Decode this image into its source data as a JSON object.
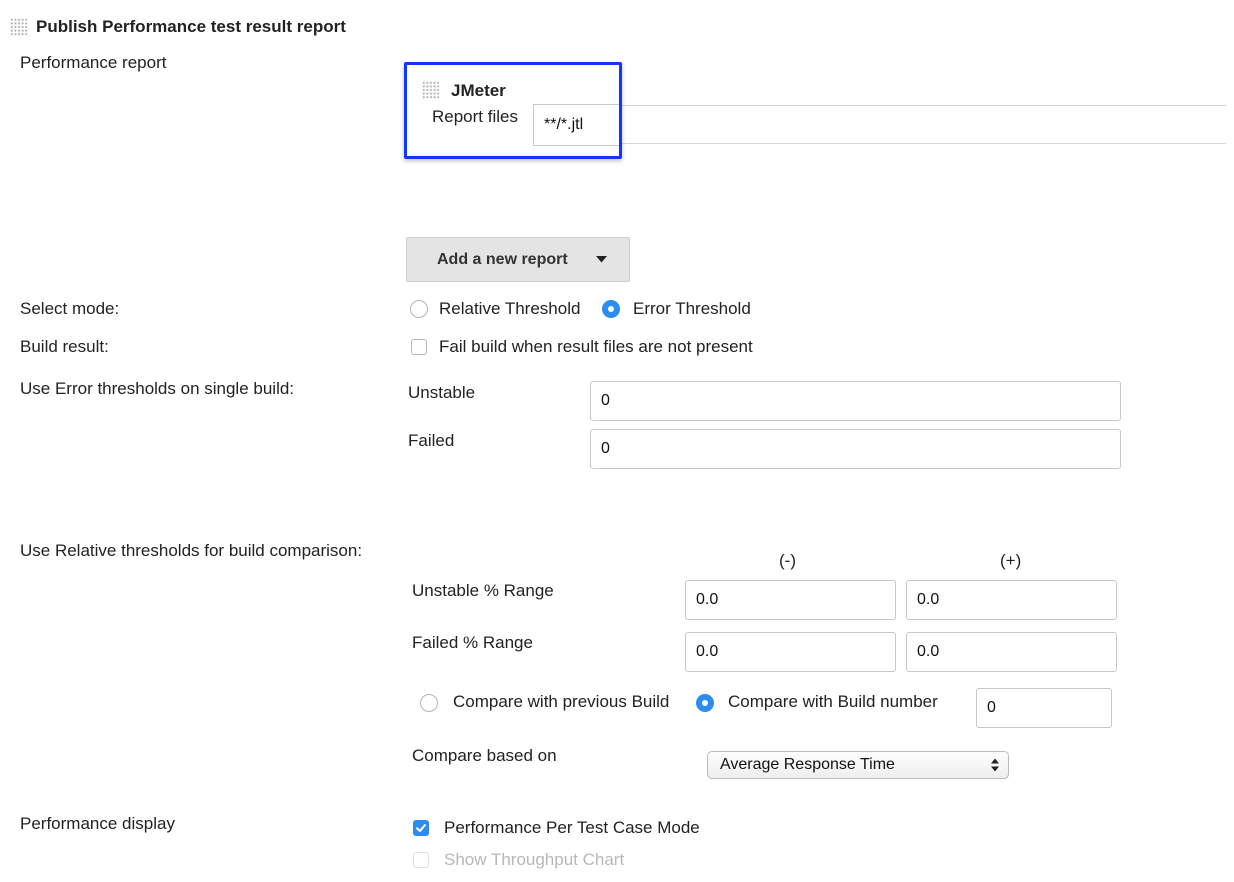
{
  "section": {
    "title": "Publish Performance test result report"
  },
  "performance_report": {
    "label": "Performance report",
    "reporter": {
      "title": "JMeter",
      "report_files_label": "Report files",
      "report_files_value": "**/*.jtl"
    },
    "add_report_button": "Add a new report",
    "highlight_color": "#1236ff"
  },
  "select_mode": {
    "label": "Select mode:",
    "options": [
      {
        "label": "Relative Threshold",
        "checked": false
      },
      {
        "label": "Error Threshold",
        "checked": true
      }
    ]
  },
  "build_result": {
    "label": "Build result:",
    "checkbox_label": "Fail build when result files are not present",
    "checked": false
  },
  "error_thresholds": {
    "label": "Use Error thresholds on single build:",
    "unstable_label": "Unstable",
    "unstable_value": "0",
    "failed_label": "Failed",
    "failed_value": "0"
  },
  "relative_thresholds": {
    "label": "Use Relative thresholds for build comparison:",
    "minus_header": "(-)",
    "plus_header": "(+)",
    "unstable_label": "Unstable % Range",
    "unstable_minus": "0.0",
    "unstable_plus": "0.0",
    "failed_label": "Failed % Range",
    "failed_minus": "0.0",
    "failed_plus": "0.0",
    "compare_options": [
      {
        "label": "Compare with previous Build",
        "checked": false
      },
      {
        "label": "Compare with Build number",
        "checked": true
      }
    ],
    "build_number_value": "0",
    "compare_based_on_label": "Compare based on",
    "compare_based_on_value": "Average Response Time"
  },
  "performance_display": {
    "label": "Performance display",
    "options": [
      {
        "label": "Performance Per Test Case Mode",
        "checked": true
      },
      {
        "label": "Show Throughput Chart",
        "checked": false
      }
    ]
  },
  "colors": {
    "accent": "#2d8cf0"
  }
}
